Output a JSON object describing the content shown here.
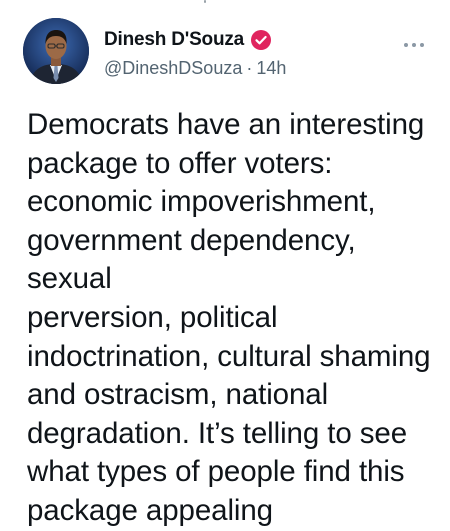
{
  "tweet": {
    "author": {
      "display_name": "Dinesh D'Souza",
      "handle": "@DineshDSouza",
      "verified": true
    },
    "separator": "·",
    "timestamp": "14h",
    "more_icon": "more-horizontal-icon",
    "text": "Democrats have an interesting\npackage to offer voters:\neconomic impoverishment,\ngovernment dependency, sexual\nperversion, political\nindoctrination, cultural shaming\nand ostracism, national\ndegradation. It’s telling to see\nwhat types of people find this\npackage appealing"
  },
  "colors": {
    "text_primary": "#0f1419",
    "text_secondary": "#536471",
    "verified_badge": "#e0245e",
    "background": "#ffffff"
  }
}
